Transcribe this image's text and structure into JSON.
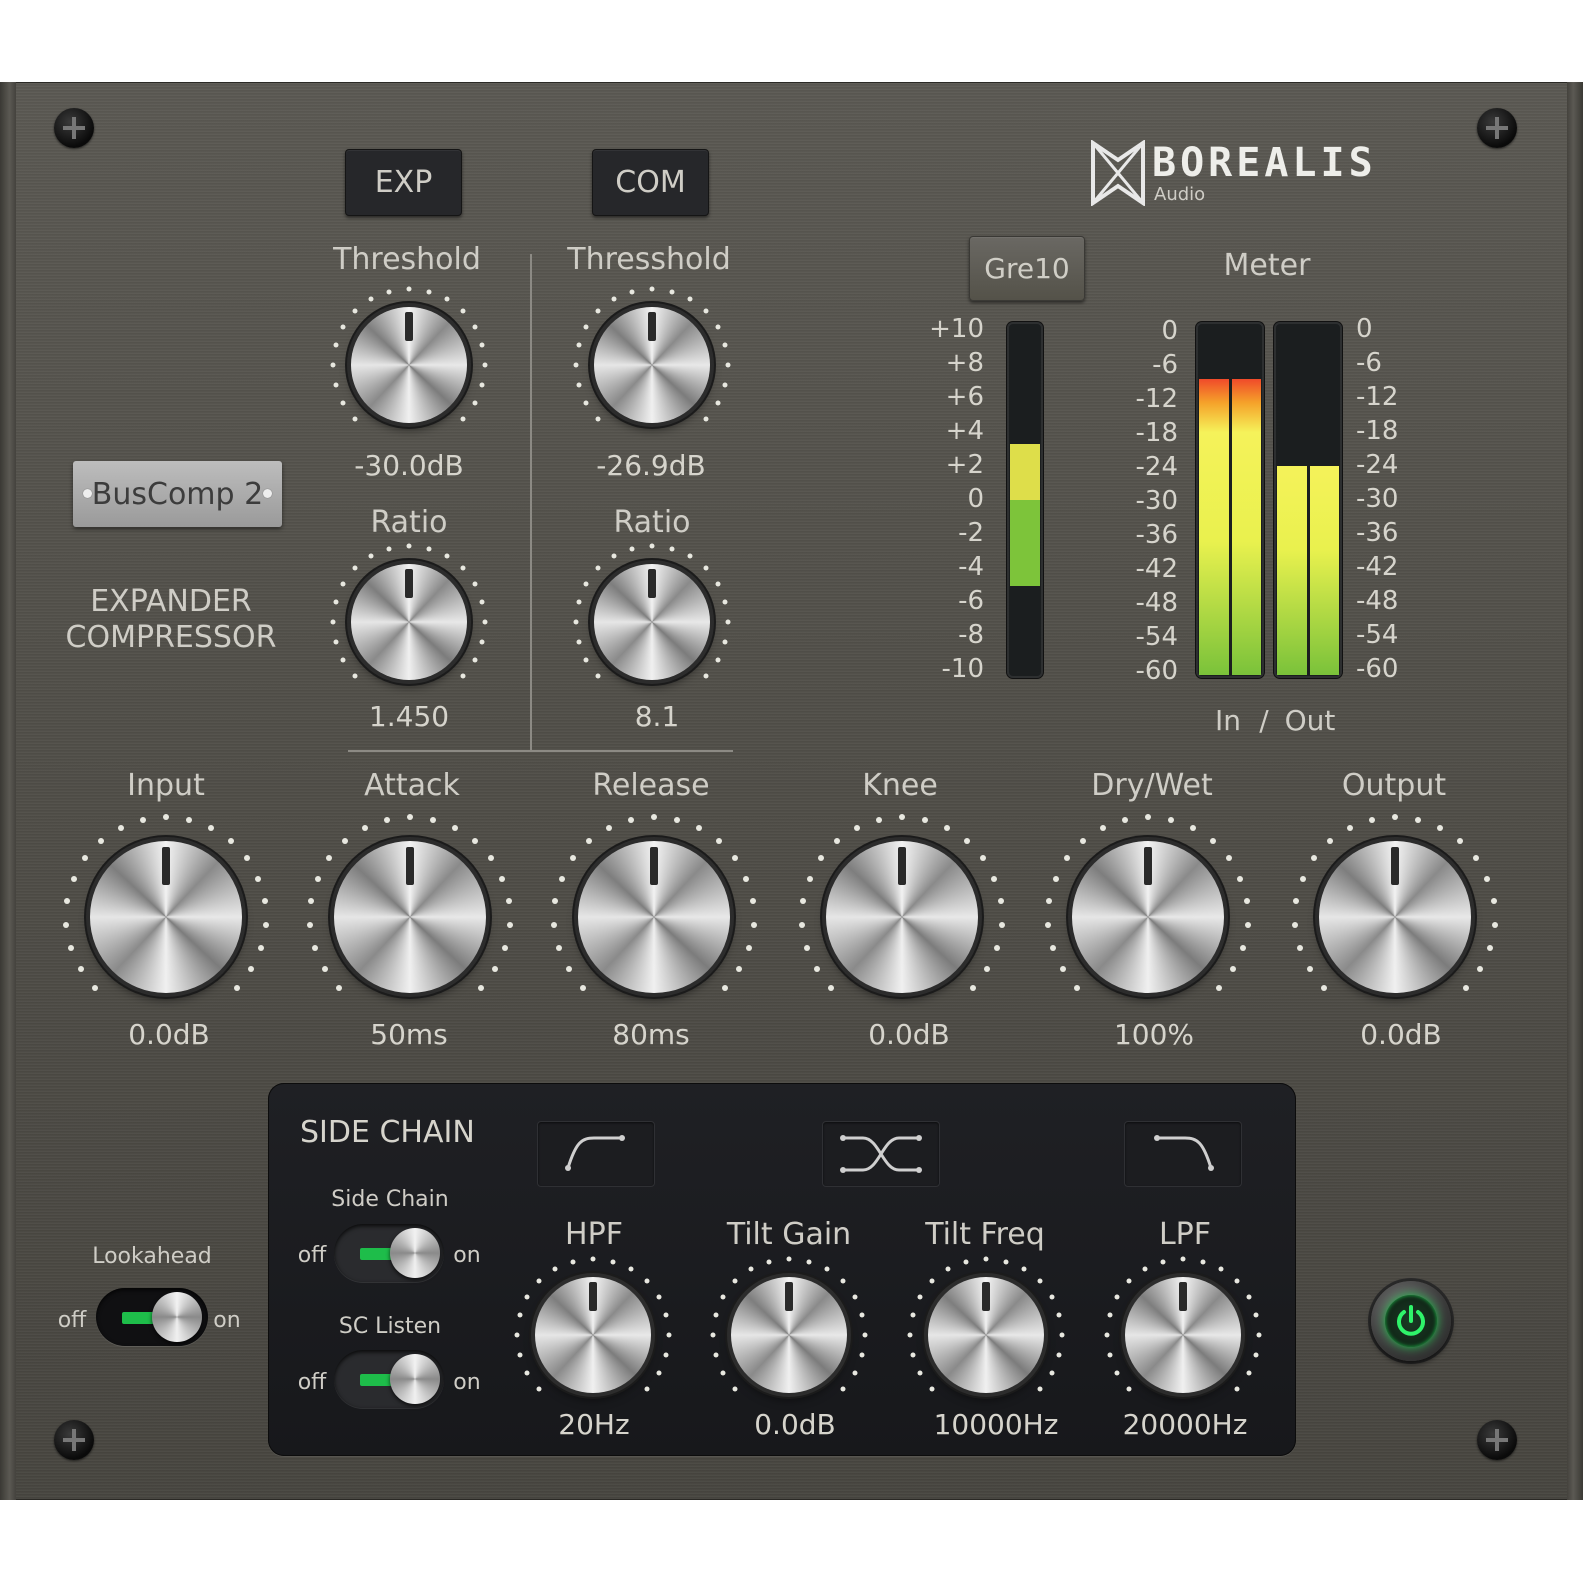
{
  "brand": {
    "name": "BOREALIS",
    "sub": "Audio"
  },
  "preset_plate": "BusComp 2",
  "plugin_type": {
    "line1": "EXPANDER",
    "line2": "COMPRESSOR"
  },
  "mode_buttons": {
    "exp": "EXP",
    "com": "COM"
  },
  "expander": {
    "threshold": {
      "label": "Threshold",
      "value": "-30.0dB"
    },
    "ratio": {
      "label": "Ratio",
      "value": "1.450"
    }
  },
  "compressor": {
    "threshold": {
      "label": "Thresshold",
      "value": "-26.9dB"
    },
    "ratio": {
      "label": "Ratio",
      "value": "8.1"
    }
  },
  "gr": {
    "button": "Gre10",
    "scale": [
      "+10",
      "+8",
      "+6",
      "+4",
      "+2",
      "0",
      "-2",
      "-4",
      "-6",
      "-8",
      "-10"
    ],
    "level_top": 0.35,
    "level_bottom": 0.74
  },
  "meter": {
    "title": "Meter",
    "scale": [
      "0",
      "-6",
      "-12",
      "-18",
      "-24",
      "-30",
      "-36",
      "-42",
      "-48",
      "-54",
      "-60"
    ],
    "in_label": "In",
    "separator": "/",
    "out_label": "Out",
    "in_level": 0.84,
    "out_level": 0.6
  },
  "main_knobs": [
    {
      "label": "Input",
      "value": "0.0dB"
    },
    {
      "label": "Attack",
      "value": "50ms"
    },
    {
      "label": "Release",
      "value": "80ms"
    },
    {
      "label": "Knee",
      "value": "0.0dB"
    },
    {
      "label": "Dry/Wet",
      "value": "100%"
    },
    {
      "label": "Output",
      "value": "0.0dB"
    }
  ],
  "lookahead": {
    "label": "Lookahead",
    "off": "off",
    "on": "on"
  },
  "side_chain": {
    "title": "SIDE CHAIN",
    "sc_toggle": {
      "label": "Side Chain",
      "off": "off",
      "on": "on"
    },
    "listen_toggle": {
      "label": "SC Listen",
      "off": "off",
      "on": "on"
    },
    "knobs": [
      {
        "label": "HPF",
        "value": "20Hz"
      },
      {
        "label": "Tilt Gain",
        "value": "0.0dB"
      },
      {
        "label": "Tilt Freq",
        "value": "10000Hz"
      },
      {
        "label": "LPF",
        "value": "20000Hz"
      }
    ]
  },
  "colors": {
    "power_led": "#1ebd4a",
    "meter_yellow": "#f5f25a",
    "meter_green": "#7ac23a",
    "meter_red": "#f04a2a"
  }
}
